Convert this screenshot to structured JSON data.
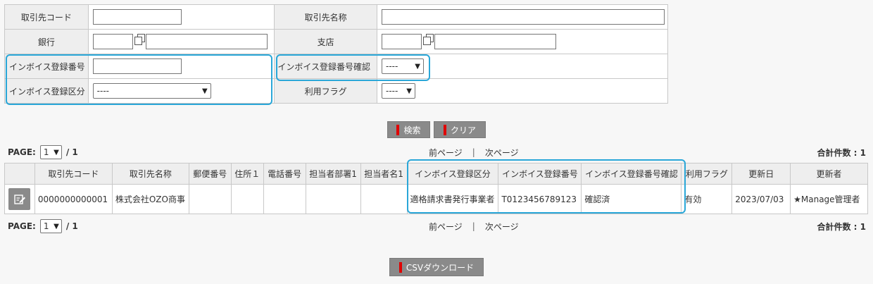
{
  "form": {
    "code_label": "取引先コード",
    "name_label": "取引先名称",
    "bank_label": "銀行",
    "branch_label": "支店",
    "invoice_no_label": "インボイス登録番号",
    "invoice_confirm_label": "インボイス登録番号確認",
    "invoice_confirm_value": "----",
    "invoice_kubun_label": "インボイス登録区分",
    "invoice_kubun_value": "----",
    "usage_flag_label": "利用フラグ",
    "usage_flag_value": "----"
  },
  "buttons": {
    "search": "検索",
    "clear": "クリア",
    "csv": "CSVダウンロード"
  },
  "pager": {
    "page_label": "PAGE:",
    "page_value": "1",
    "page_total": "/ 1",
    "prev": "前ページ",
    "separator": "|",
    "next": "次ページ",
    "total": "合計件数 : 1"
  },
  "table": {
    "headers": [
      "取引先コード",
      "取引先名称",
      "郵便番号",
      "住所１",
      "電話番号",
      "担当者部署1",
      "担当者名1",
      "インボイス登録区分",
      "インボイス登録番号",
      "インボイス登録番号確認",
      "利用フラグ",
      "更新日",
      "更新者"
    ],
    "rows": [
      [
        "0000000000001",
        "株式会社OZO商事",
        "",
        "",
        "",
        "",
        "",
        "適格請求書発行事業者",
        "T0123456789123",
        "確認済",
        "有効",
        "2023/07/03",
        "★Manage管理者"
      ]
    ]
  },
  "icons": {
    "edit": "edit-icon",
    "copy": "copy-icon",
    "dropdown": "chevron-down-icon"
  },
  "colors": {
    "highlight": "#2aa7d8",
    "button_bg": "#8a8a8a",
    "button_accent": "#e00000"
  }
}
